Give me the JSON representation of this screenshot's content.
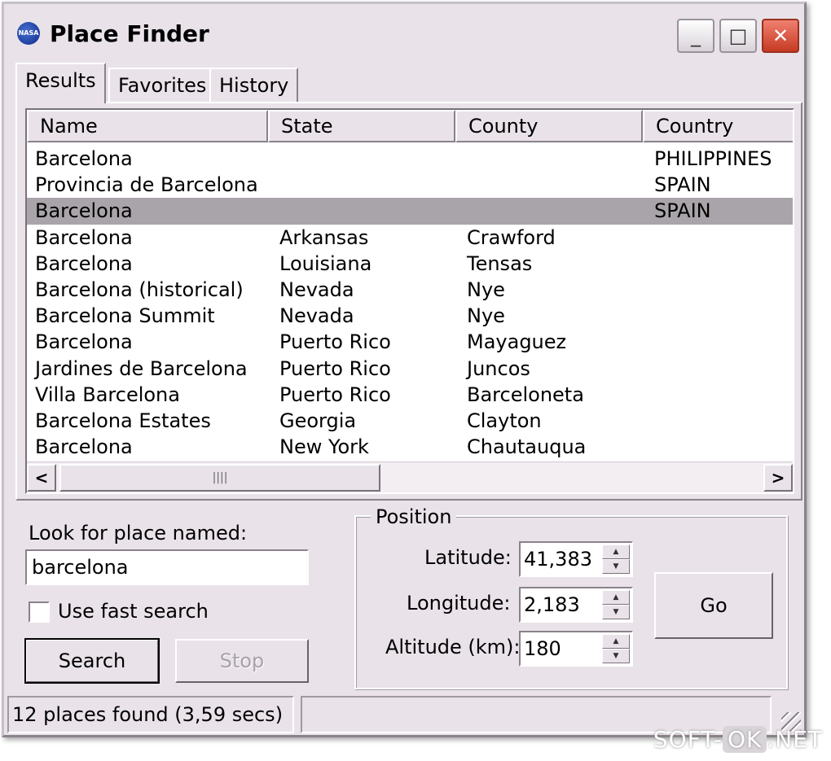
{
  "window": {
    "title": "Place Finder",
    "app_icon_text": "NASA",
    "minimize_glyph": "_",
    "maximize_glyph": "□",
    "close_glyph": "✕"
  },
  "tabs": [
    {
      "label": "Results",
      "active": true
    },
    {
      "label": "Favorites",
      "active": false
    },
    {
      "label": "History",
      "active": false
    }
  ],
  "results": {
    "columns": [
      "Name",
      "State",
      "County",
      "Country"
    ],
    "rows": [
      {
        "name": "Barcelona",
        "state": "",
        "county": "",
        "country": "PHILIPPINES",
        "selected": false
      },
      {
        "name": "Provincia de Barcelona",
        "state": "",
        "county": "",
        "country": "SPAIN",
        "selected": false
      },
      {
        "name": "Barcelona",
        "state": "",
        "county": "",
        "country": "SPAIN",
        "selected": true
      },
      {
        "name": "Barcelona",
        "state": "Arkansas",
        "county": "Crawford",
        "country": "",
        "selected": false
      },
      {
        "name": "Barcelona",
        "state": "Louisiana",
        "county": "Tensas",
        "country": "",
        "selected": false
      },
      {
        "name": "Barcelona (historical)",
        "state": "Nevada",
        "county": "Nye",
        "country": "",
        "selected": false
      },
      {
        "name": "Barcelona Summit",
        "state": "Nevada",
        "county": "Nye",
        "country": "",
        "selected": false
      },
      {
        "name": "Barcelona",
        "state": "Puerto Rico",
        "county": "Mayaguez",
        "country": "",
        "selected": false
      },
      {
        "name": "Jardines de Barcelona",
        "state": "Puerto Rico",
        "county": "Juncos",
        "country": "",
        "selected": false
      },
      {
        "name": "Villa Barcelona",
        "state": "Puerto Rico",
        "county": "Barceloneta",
        "country": "",
        "selected": false
      },
      {
        "name": "Barcelona Estates",
        "state": "Georgia",
        "county": "Clayton",
        "country": "",
        "selected": false
      },
      {
        "name": "Barcelona",
        "state": "New York",
        "county": "Chautauqua",
        "country": "",
        "selected": false
      }
    ],
    "scroll_left_glyph": "<",
    "scroll_right_glyph": ">",
    "thumb_grip": "||||"
  },
  "search": {
    "label": "Look for place named:",
    "value": "barcelona",
    "fast_search_label": "Use fast search",
    "fast_search_checked": false,
    "search_button": "Search",
    "stop_button": "Stop"
  },
  "position": {
    "group_title": "Position",
    "latitude_label": "Latitude:",
    "latitude_value": "41,383",
    "longitude_label": "Longitude:",
    "longitude_value": "2,183",
    "altitude_label": "Altitude (km):",
    "altitude_value": "180",
    "spin_up_glyph": "▲",
    "spin_down_glyph": "▼",
    "go_button": "Go"
  },
  "status": {
    "text": "12 places found (3,59 secs)",
    "second_pane": ""
  },
  "watermark": {
    "left": "SOFT-",
    "mid": "OK",
    "right": ".NET"
  }
}
